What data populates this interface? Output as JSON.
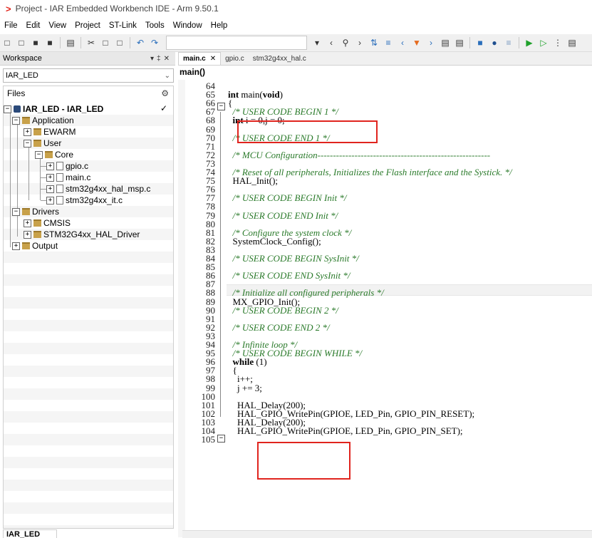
{
  "window": {
    "title": "Project - IAR Embedded Workbench IDE - Arm 9.50.1"
  },
  "menu": [
    "File",
    "Edit",
    "View",
    "Project",
    "ST-Link",
    "Tools",
    "Window",
    "Help"
  ],
  "workspace": {
    "header": "Workspace",
    "config": "IAR_LED",
    "files_label": "Files",
    "bottom_tab": "IAR_LED",
    "tree": [
      "IAR_LED - IAR_LED",
      "Application",
      "EWARM",
      "User",
      "Core",
      "gpio.c",
      "main.c",
      "stm32g4xx_hal_msp.c",
      "stm32g4xx_it.c",
      "Drivers",
      "CMSIS",
      "STM32G4xx_HAL_Driver",
      "Output"
    ]
  },
  "editor": {
    "tabs": [
      "main.c",
      "gpio.c",
      "stm32g4xx_hal.c"
    ],
    "breadcrumb": "main()",
    "lines": [
      {
        "n": "64",
        "t": ""
      },
      {
        "n": "65",
        "t": "int main(void)"
      },
      {
        "n": "66",
        "t": "{"
      },
      {
        "n": "67",
        "t": "  /* USER CODE BEGIN 1 */"
      },
      {
        "n": "68",
        "t": "  int i = 0,j = 0;"
      },
      {
        "n": "69",
        "t": ""
      },
      {
        "n": "70",
        "t": "  /* USER CODE END 1 */"
      },
      {
        "n": "71",
        "t": ""
      },
      {
        "n": "72",
        "t": "  /* MCU Configuration--------------------------------------------------------"
      },
      {
        "n": "73",
        "t": ""
      },
      {
        "n": "74",
        "t": "  /* Reset of all peripherals, Initializes the Flash interface and the Systick. */"
      },
      {
        "n": "75",
        "t": "  HAL_Init();"
      },
      {
        "n": "76",
        "t": ""
      },
      {
        "n": "77",
        "t": "  /* USER CODE BEGIN Init */"
      },
      {
        "n": "78",
        "t": ""
      },
      {
        "n": "79",
        "t": "  /* USER CODE END Init */"
      },
      {
        "n": "80",
        "t": ""
      },
      {
        "n": "81",
        "t": "  /* Configure the system clock */"
      },
      {
        "n": "82",
        "t": "  SystemClock_Config();"
      },
      {
        "n": "83",
        "t": ""
      },
      {
        "n": "84",
        "t": "  /* USER CODE BEGIN SysInit */"
      },
      {
        "n": "85",
        "t": ""
      },
      {
        "n": "86",
        "t": "  /* USER CODE END SysInit */"
      },
      {
        "n": "87",
        "t": ""
      },
      {
        "n": "88",
        "t": "  /* Initialize all configured peripherals */"
      },
      {
        "n": "89",
        "t": "  MX_GPIO_Init();"
      },
      {
        "n": "90",
        "t": "  /* USER CODE BEGIN 2 */"
      },
      {
        "n": "91",
        "t": ""
      },
      {
        "n": "92",
        "t": "  /* USER CODE END 2 */"
      },
      {
        "n": "93",
        "t": ""
      },
      {
        "n": "94",
        "t": "  /* Infinite loop */"
      },
      {
        "n": "95",
        "t": "  /* USER CODE BEGIN WHILE */"
      },
      {
        "n": "96",
        "t": "  while (1)"
      },
      {
        "n": "97",
        "t": "  {"
      },
      {
        "n": "98",
        "t": "    i++;"
      },
      {
        "n": "99",
        "t": "    j += 3;"
      },
      {
        "n": "100",
        "t": ""
      },
      {
        "n": "101",
        "t": "    HAL_Delay(200);"
      },
      {
        "n": "102",
        "t": "    HAL_GPIO_WritePin(GPIOE, LED_Pin, GPIO_PIN_RESET);"
      },
      {
        "n": "103",
        "t": "    HAL_Delay(200);"
      },
      {
        "n": "104",
        "t": "    HAL_GPIO_WritePin(GPIOE, LED_Pin, GPIO_PIN_SET);"
      },
      {
        "n": "105",
        "t": ""
      }
    ]
  },
  "colors": {
    "accent_red": "#e0241e",
    "comment_green": "#2a7a2a"
  },
  "icons": [
    "iar-logo-icon",
    "new-file-icon",
    "open-icon",
    "save-icon",
    "save-all-icon",
    "print-icon",
    "cut-icon",
    "copy-icon",
    "paste-icon",
    "undo-icon",
    "redo-icon",
    "search-icon",
    "run-icon",
    "gear-icon",
    "dropdown-icon"
  ]
}
